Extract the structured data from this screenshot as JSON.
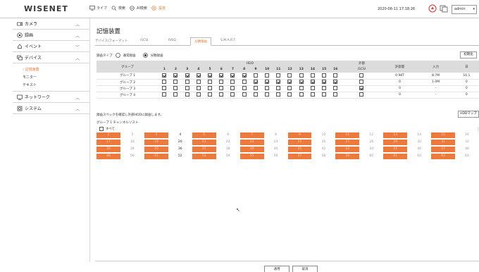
{
  "topbar": {
    "logo": "WISENET",
    "nav": [
      {
        "label": "ライブ",
        "icon": "monitor-icon"
      },
      {
        "label": "検索",
        "icon": "search-icon"
      },
      {
        "label": "AI検索",
        "icon": "ai-search-icon"
      },
      {
        "label": "設定",
        "icon": "settings-icon"
      }
    ],
    "datetime": "2020-06-11 17:18:26",
    "user": "admin"
  },
  "sidebar": {
    "sections": [
      {
        "label": "カメラ",
        "icon": "camera-icon",
        "chevron": "up"
      },
      {
        "label": "録画",
        "icon": "record-icon",
        "chevron": "up"
      },
      {
        "label": "イベント",
        "icon": "event-icon",
        "chevron": "down"
      },
      {
        "label": "デバイス",
        "icon": "device-icon",
        "chevron": "up"
      }
    ],
    "device_items": [
      {
        "label": "記憶装置",
        "active": true
      },
      {
        "label": "モニター",
        "active": false
      },
      {
        "label": "テキスト",
        "active": false
      }
    ],
    "bottom_sections": [
      {
        "label": "ネットワーク",
        "icon": "network-icon",
        "chevron": "up"
      },
      {
        "label": "システム",
        "icon": "system-icon",
        "chevron": "up"
      }
    ]
  },
  "main": {
    "title": "記憶装置",
    "tabs": [
      "デバイス/フォーマット",
      "iSCSI",
      "RAID",
      "分散録画",
      "S.M.A.R.T"
    ],
    "active_tab": 3,
    "record_type_label": "録画タイプ",
    "radio_normal": "通常録画",
    "radio_split": "分散録画",
    "init_button": "初期化",
    "table": {
      "col_group": "グループ",
      "col_hdd": "HDD",
      "col_external": "外部",
      "col_iscsi": "iSCSI",
      "col_capacity": "許容量",
      "col_input": "入力",
      "col_day": "日",
      "hdd_numbers": [
        "1",
        "2",
        "3",
        "4",
        "5",
        "6",
        "7",
        "8",
        "9",
        "10",
        "11",
        "12",
        "13",
        "14",
        "15",
        "16"
      ],
      "rows": [
        {
          "name": "グループ 1",
          "checks": [
            1,
            1,
            1,
            1,
            1,
            1,
            1,
            1,
            0,
            0,
            0,
            0,
            0,
            0,
            0,
            0
          ],
          "iscsi": 0,
          "capacity": "0.98T",
          "input": "8.7M",
          "day": "10.1"
        },
        {
          "name": "グループ 2",
          "checks": [
            0,
            0,
            0,
            0,
            0,
            0,
            0,
            0,
            1,
            1,
            1,
            1,
            1,
            1,
            1,
            1
          ],
          "iscsi": 0,
          "capacity": "0",
          "input": "1.0M",
          "day": "0"
        },
        {
          "name": "グループ 3",
          "checks": [
            0,
            0,
            0,
            0,
            0,
            0,
            0,
            0,
            0,
            0,
            0,
            0,
            0,
            0,
            0,
            0
          ],
          "iscsi": 1,
          "capacity": "0",
          "input": "-",
          "day": "0"
        },
        {
          "name": "グループ 4",
          "checks": [
            0,
            0,
            0,
            0,
            0,
            0,
            0,
            0,
            0,
            0,
            0,
            0,
            0,
            0,
            0,
            0
          ],
          "iscsi": 0,
          "capacity": "0",
          "input": "-",
          "day": "0"
        }
      ]
    },
    "note": "録画スペックを確認し外部HDDに録画します。",
    "hdd_map_button": "HDDマップ",
    "channel_list_label": "グループ 1 チャンネルリスト",
    "all_label": "すべて",
    "channels": [
      {
        "n": "1",
        "s": "on"
      },
      {
        "n": "2",
        "s": "off"
      },
      {
        "n": "3",
        "s": "on"
      },
      {
        "n": "4",
        "s": "dark"
      },
      {
        "n": "5",
        "s": "on"
      },
      {
        "n": "6",
        "s": "off"
      },
      {
        "n": "7",
        "s": "on"
      },
      {
        "n": "8",
        "s": "off"
      },
      {
        "n": "9",
        "s": "on"
      },
      {
        "n": "10",
        "s": "off"
      },
      {
        "n": "11",
        "s": "on"
      },
      {
        "n": "12",
        "s": "off"
      },
      {
        "n": "13",
        "s": "on"
      },
      {
        "n": "14",
        "s": "off"
      },
      {
        "n": "15",
        "s": "on"
      },
      {
        "n": "16",
        "s": "off"
      },
      {
        "n": "17",
        "s": "on"
      },
      {
        "n": "18",
        "s": "off"
      },
      {
        "n": "19",
        "s": "on"
      },
      {
        "n": "20",
        "s": "dark"
      },
      {
        "n": "21",
        "s": "on"
      },
      {
        "n": "22",
        "s": "off"
      },
      {
        "n": "23",
        "s": "on"
      },
      {
        "n": "24",
        "s": "off"
      },
      {
        "n": "25",
        "s": "on"
      },
      {
        "n": "26",
        "s": "off"
      },
      {
        "n": "27",
        "s": "on"
      },
      {
        "n": "28",
        "s": "off"
      },
      {
        "n": "29",
        "s": "on"
      },
      {
        "n": "30",
        "s": "off"
      },
      {
        "n": "31",
        "s": "on"
      },
      {
        "n": "32",
        "s": "off"
      },
      {
        "n": "33",
        "s": "on"
      },
      {
        "n": "34",
        "s": "off"
      },
      {
        "n": "35",
        "s": "on"
      },
      {
        "n": "36",
        "s": "dark"
      },
      {
        "n": "37",
        "s": "on"
      },
      {
        "n": "38",
        "s": "off"
      },
      {
        "n": "39",
        "s": "on"
      },
      {
        "n": "40",
        "s": "off"
      },
      {
        "n": "41",
        "s": "on"
      },
      {
        "n": "42",
        "s": "off"
      },
      {
        "n": "43",
        "s": "on"
      },
      {
        "n": "44",
        "s": "off"
      },
      {
        "n": "45",
        "s": "on"
      },
      {
        "n": "46",
        "s": "off"
      },
      {
        "n": "47",
        "s": "on"
      },
      {
        "n": "48",
        "s": "off"
      },
      {
        "n": "49",
        "s": "on"
      },
      {
        "n": "50",
        "s": "off"
      },
      {
        "n": "51",
        "s": "on"
      },
      {
        "n": "52",
        "s": "dark"
      },
      {
        "n": "53",
        "s": "on"
      },
      {
        "n": "54",
        "s": "off"
      },
      {
        "n": "55",
        "s": "on"
      },
      {
        "n": "56",
        "s": "off"
      },
      {
        "n": "57",
        "s": "on"
      },
      {
        "n": "58",
        "s": "off"
      },
      {
        "n": "59",
        "s": "on"
      },
      {
        "n": "60",
        "s": "off"
      },
      {
        "n": "61",
        "s": "on"
      },
      {
        "n": "62",
        "s": "off"
      },
      {
        "n": "63",
        "s": "on"
      },
      {
        "n": "64",
        "s": "off"
      }
    ],
    "apply_button": "適用",
    "cancel_button": "取消"
  },
  "colors": {
    "accent": "#e8762d",
    "channel_on": "#ec7a3c"
  }
}
